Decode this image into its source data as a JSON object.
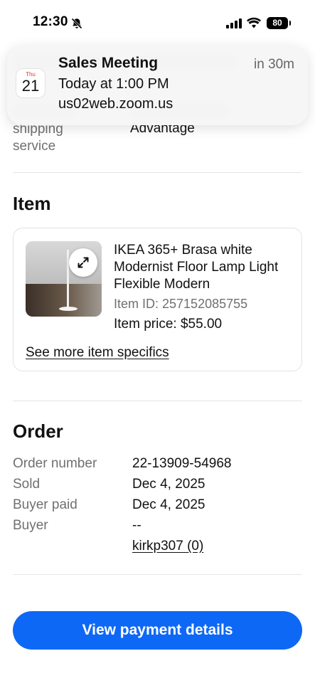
{
  "status_bar": {
    "time": "12:30",
    "battery": "80",
    "icons": [
      "bell-off-icon",
      "signal-icon",
      "wifi-icon",
      "battery-icon"
    ]
  },
  "notification": {
    "app_icon": "calendar-icon",
    "calendar_day": "Thu",
    "calendar_date": "21",
    "title": "Sales Meeting",
    "time_until": "in 30m",
    "line1": "Today at 1:00 PM",
    "line2": "us02web.zoom.us"
  },
  "shipping": {
    "label": "shipping service",
    "value": "Advantage"
  },
  "item_section": {
    "title": "Item",
    "name": "IKEA 365+ Brasa white Modernist Floor Lamp Light Flexible Modern",
    "item_id": "Item ID: 257152085755",
    "price": "Item price: $55.00",
    "specifics_link": "See more item specifics",
    "expand_icon": "expand-icon"
  },
  "order_section": {
    "title": "Order",
    "rows": [
      {
        "label": "Order number",
        "value": "22-13909-54968"
      },
      {
        "label": "Sold",
        "value": "Dec 4, 2025"
      },
      {
        "label": "Buyer paid",
        "value": "Dec 4, 2025"
      },
      {
        "label": "Buyer",
        "value": "--"
      }
    ],
    "buyer_link": "kirkp307 (0)"
  },
  "actions": {
    "view_payment": "View payment details"
  },
  "colors": {
    "accent": "#0e68f6",
    "muted_text": "#707070",
    "calendar_red": "#e6352b"
  }
}
